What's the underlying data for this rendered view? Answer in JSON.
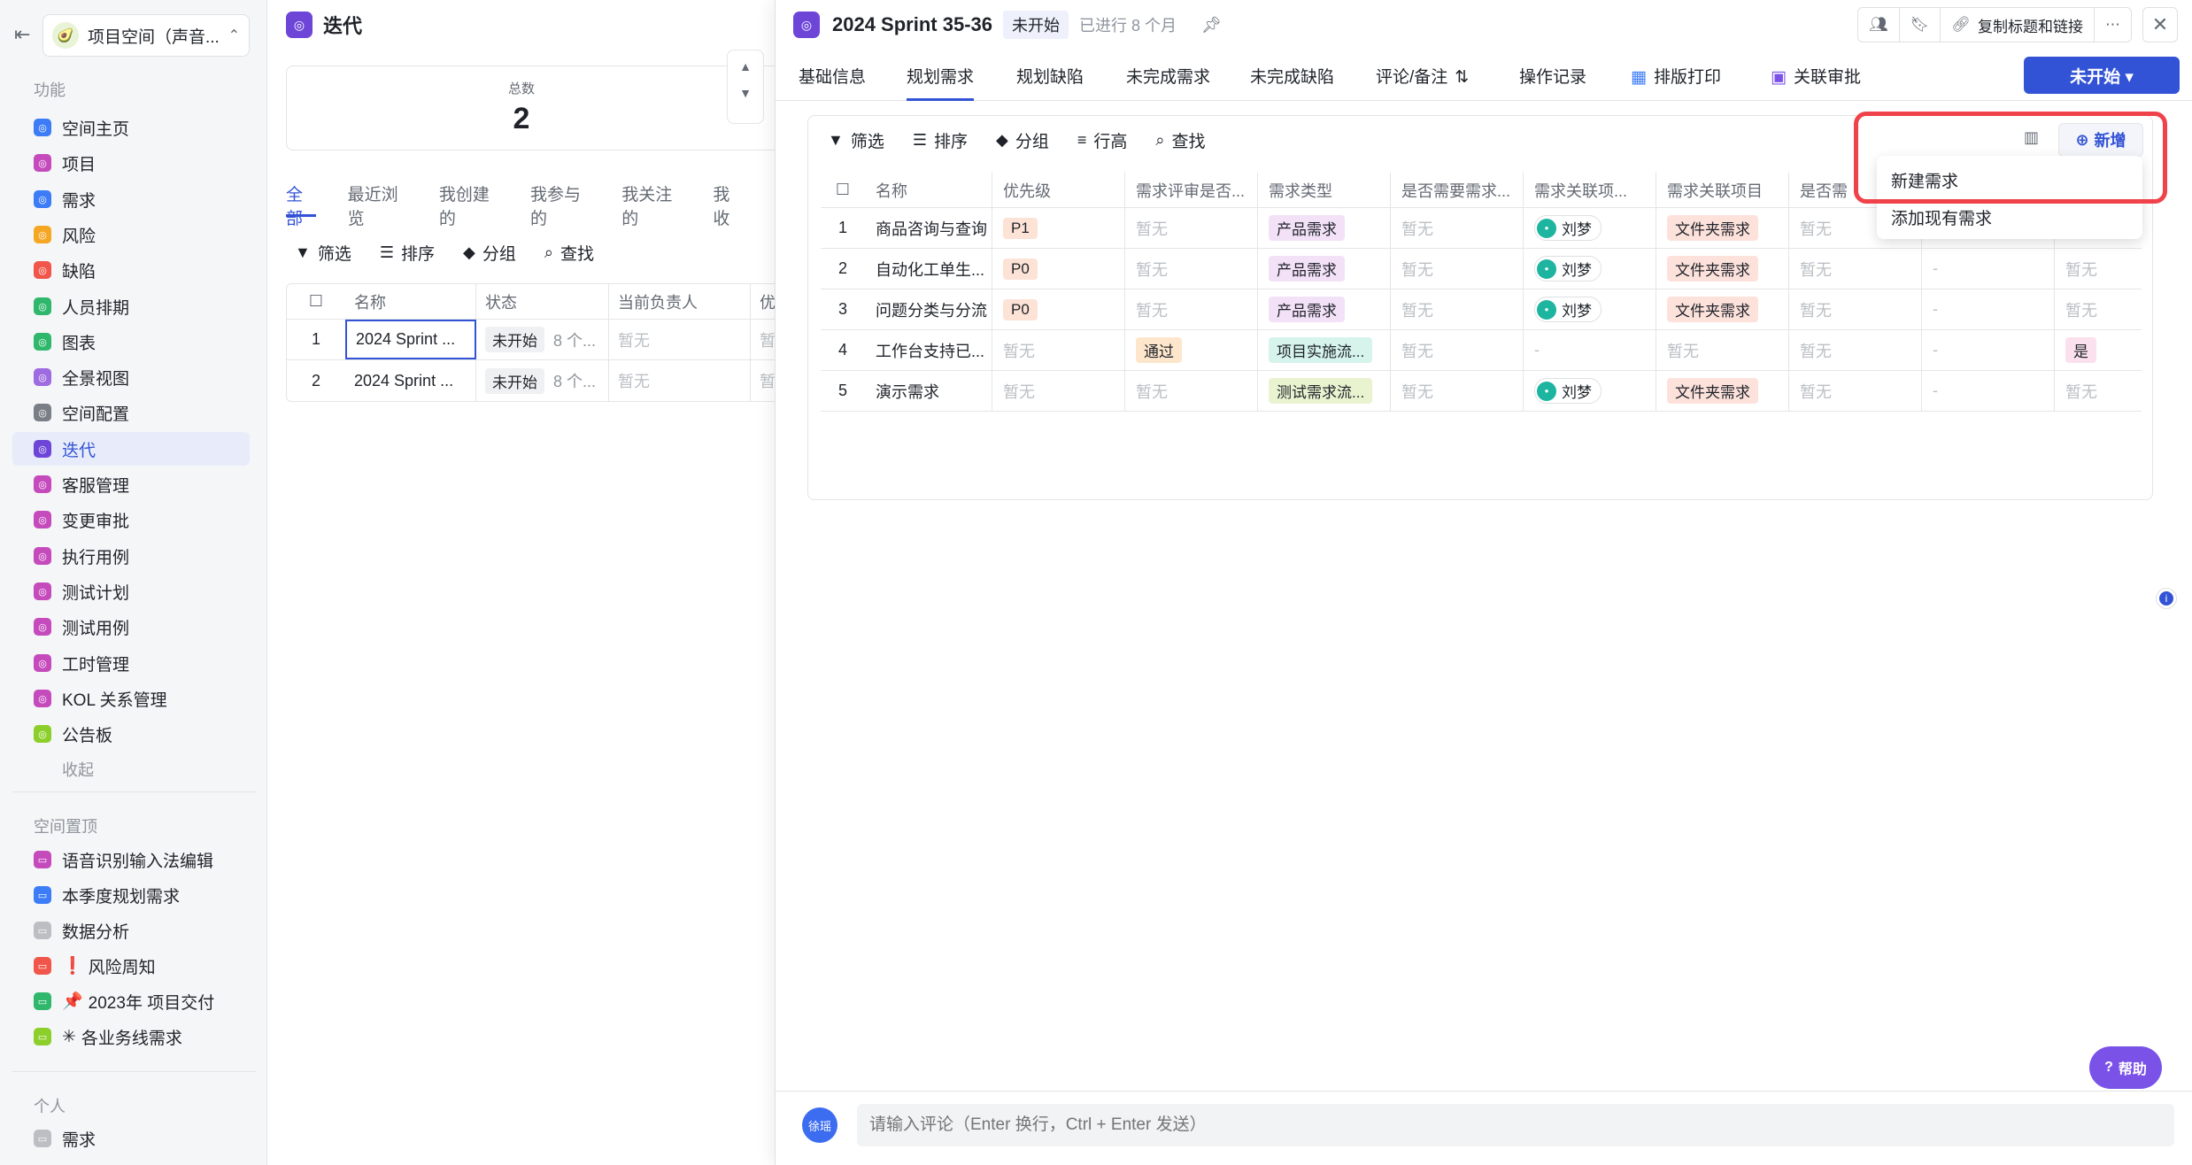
{
  "sidebar": {
    "space_name": "项目空间（声音...",
    "func_title": "功能",
    "items": [
      {
        "label": "空间主页",
        "color": "#3c7cf6"
      },
      {
        "label": "项目",
        "color": "#c54bbd"
      },
      {
        "label": "需求",
        "color": "#3c7cf6"
      },
      {
        "label": "风险",
        "color": "#f5a623"
      },
      {
        "label": "缺陷",
        "color": "#f0574a"
      },
      {
        "label": "人员排期",
        "color": "#2fb86b"
      },
      {
        "label": "图表",
        "color": "#2fb86b"
      },
      {
        "label": "全景视图",
        "color": "#9e6be0"
      },
      {
        "label": "空间配置",
        "color": "#7a7f87"
      },
      {
        "label": "迭代",
        "color": "#6d46d8"
      },
      {
        "label": "客服管理",
        "color": "#c54bbd"
      },
      {
        "label": "变更审批",
        "color": "#c54bbd"
      },
      {
        "label": "执行用例",
        "color": "#c54bbd"
      },
      {
        "label": "测试计划",
        "color": "#c54bbd"
      },
      {
        "label": "测试用例",
        "color": "#c54bbd"
      },
      {
        "label": "工时管理",
        "color": "#c54bbd"
      },
      {
        "label": "KOL 关系管理",
        "color": "#c54bbd"
      },
      {
        "label": "公告板",
        "color": "#8ccf2a"
      }
    ],
    "collapse_label": "收起",
    "pinned_title": "空间置顶",
    "pinned": [
      {
        "label": "语音识别输入法编辑",
        "color": "#c54bbd",
        "emoji": ""
      },
      {
        "label": "本季度规划需求",
        "color": "#3c7cf6",
        "emoji": ""
      },
      {
        "label": "数据分析",
        "color": "#bbbfc4",
        "emoji": ""
      },
      {
        "label": "风险周知",
        "color": "#f0574a",
        "emoji": "❗"
      },
      {
        "label": "2023年 项目交付",
        "color": "#2fb86b",
        "emoji": "📌"
      },
      {
        "label": "各业务线需求",
        "color": "#8ccf2a",
        "emoji": "✳"
      }
    ],
    "personal_title": "个人",
    "personal": [
      {
        "label": "需求"
      }
    ]
  },
  "list_panel": {
    "title": "迭代",
    "stat_label": "总数",
    "stat_value": "2",
    "tabs": [
      "全部",
      "最近浏览",
      "我创建的",
      "我参与的",
      "我关注的",
      "我收"
    ],
    "tools": [
      "筛选",
      "排序",
      "分组",
      "查找"
    ],
    "columns": [
      "名称",
      "状态",
      "当前负责人",
      "优"
    ],
    "rows": [
      {
        "idx": "1",
        "name": "2024 Sprint ...",
        "status": "未开始",
        "extra": "8 个...",
        "owner": "暂无",
        "p": "暂"
      },
      {
        "idx": "2",
        "name": "2024 Sprint ...",
        "status": "未开始",
        "extra": "8 个...",
        "owner": "暂无",
        "p": "暂"
      }
    ]
  },
  "detail": {
    "title": "2024 Sprint 35-36",
    "status": "未开始",
    "progress": "已进行 8 个月",
    "copy_label": "复制标题和链接",
    "tabs": [
      "基础信息",
      "规划需求",
      "规划缺陷",
      "未完成需求",
      "未完成缺陷",
      "评论/备注",
      "操作记录",
      "排版打印",
      "关联审批"
    ],
    "status_button": "未开始 ▾",
    "tools": [
      "筛选",
      "排序",
      "分组",
      "行高",
      "查找"
    ],
    "new_label": "新增",
    "columns": [
      "名称",
      "优先级",
      "需求评审是否...",
      "需求类型",
      "是否需要需求...",
      "需求关联项...",
      "需求关联项目",
      "是否需",
      "",
      ""
    ],
    "rows": [
      {
        "idx": "1",
        "name": "商品咨询与查询",
        "priority": "P1",
        "review": "暂无",
        "type": "产品需求",
        "need": "暂无",
        "owner": "刘梦",
        "project": "文件夹需求",
        "c8": "暂无",
        "c9": "",
        "c10": ""
      },
      {
        "idx": "2",
        "name": "自动化工单生...",
        "priority": "P0",
        "review": "暂无",
        "type": "产品需求",
        "need": "暂无",
        "owner": "刘梦",
        "project": "文件夹需求",
        "c8": "暂无",
        "c9": "-",
        "c10": "暂无"
      },
      {
        "idx": "3",
        "name": "问题分类与分流",
        "priority": "P0",
        "review": "暂无",
        "type": "产品需求",
        "need": "暂无",
        "owner": "刘梦",
        "project": "文件夹需求",
        "c8": "暂无",
        "c9": "-",
        "c10": "暂无"
      },
      {
        "idx": "4",
        "name": "工作台支持已...",
        "priority": "暂无",
        "review": "通过",
        "type": "项目实施流...",
        "need": "暂无",
        "owner": "-",
        "project": "暂无",
        "c8": "暂无",
        "c9": "-",
        "c10": "是"
      },
      {
        "idx": "5",
        "name": "演示需求",
        "priority": "暂无",
        "review": "暂无",
        "type": "测试需求流...",
        "need": "暂无",
        "owner": "刘梦",
        "project": "文件夹需求",
        "c8": "暂无",
        "c9": "-",
        "c10": "暂无"
      }
    ],
    "dropdown": [
      "新建需求",
      "添加现有需求"
    ],
    "help_label": "帮助",
    "comment_avatar": "徐瑶",
    "comment_placeholder": "请输入评论（Enter 换行，Ctrl + Enter 发送）"
  }
}
